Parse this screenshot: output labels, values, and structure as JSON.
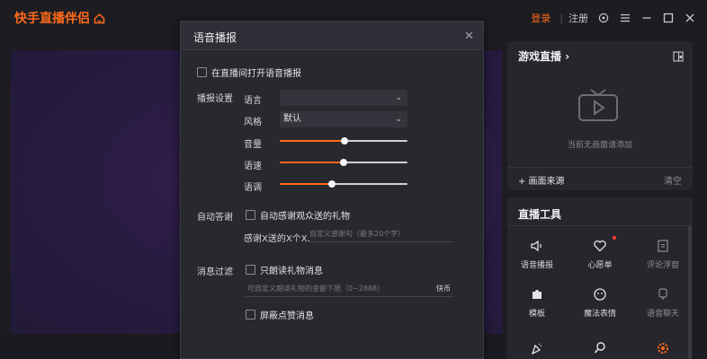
{
  "app": {
    "title": "快手直播伴侣",
    "login": "登录",
    "separator": "|",
    "register": "注册"
  },
  "dialog": {
    "title": "语音播报",
    "close": "✕",
    "enable_label": "在直播间打开语音播报",
    "broadcast_settings_label": "播报设置",
    "language_label": "语言",
    "language_value": "",
    "style_label": "风格",
    "style_value": "默认",
    "volume_label": "音量",
    "volume_level": 0.51,
    "speed_label": "语速",
    "speed_level": 0.5,
    "pitch_label": "语调",
    "pitch_level": 0.41,
    "auto_reply_section": "自动答谢",
    "auto_reply_checkbox": "自动感谢观众送的礼物",
    "thanks_prefix": "感谢X送的X个X,",
    "thanks_placeholder": "自定义感谢句（最多20个字）",
    "filter_section": "消息过滤",
    "gift_only_checkbox": "只朗读礼物消息",
    "gift_amount_placeholder": "可自定义朗读礼物的金额下限（0~2888）",
    "currency_unit": "快币",
    "block_likes_checkbox": "屏蔽点赞消息"
  },
  "game_panel": {
    "title": "游戏直播",
    "empty_text": "当前无画面请添加",
    "add_source": "+ 画面来源",
    "clear": "清空"
  },
  "tools": {
    "title": "直播工具",
    "items": [
      {
        "label": "语音播报",
        "icon": "speaker-icon"
      },
      {
        "label": "心愿单",
        "icon": "heart-icon"
      },
      {
        "label": "评论浮窗",
        "icon": "comment-window-icon"
      },
      {
        "label": "模板",
        "icon": "puzzle-icon"
      },
      {
        "label": "魔法表情",
        "icon": "magic-face-icon"
      },
      {
        "label": "语音聊天",
        "icon": "microphone-icon"
      }
    ]
  },
  "colors": {
    "accent": "#ff6a1a",
    "badge": "#ff3b30"
  }
}
